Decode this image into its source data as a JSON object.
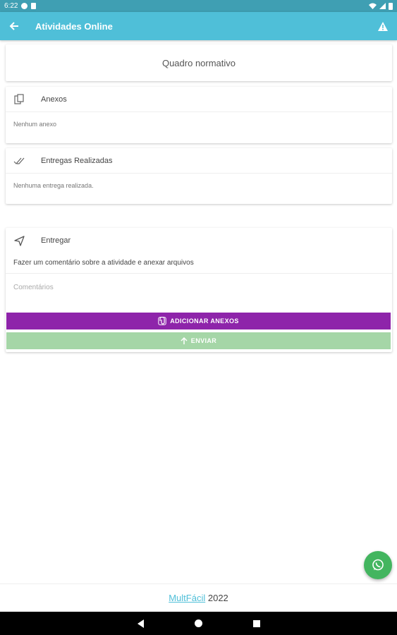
{
  "status": {
    "time": "6:22"
  },
  "appbar": {
    "title": "Atividades Online",
    "back_icon": "arrow-left-icon",
    "warning_icon": "warning-icon"
  },
  "quadro": {
    "label": "Quadro normativo"
  },
  "anexos": {
    "title": "Anexos",
    "empty": "Nenhum anexo"
  },
  "entregas": {
    "title": "Entregas Realizadas",
    "empty": "Nenhuma entrega realizada."
  },
  "entregar": {
    "title": "Entregar",
    "description": "Fazer um comentário sobre a atividade e anexar arquivos",
    "comment_placeholder": "Comentários",
    "add_label": "ADICIONAR ANEXOS",
    "send_label": "ENVIAR"
  },
  "footer": {
    "brand": "MultFácil",
    "year": "2022"
  },
  "colors": {
    "primary": "#4fbfd8",
    "add_button": "#8e24aa",
    "send_button": "#a5d6a7",
    "whatsapp": "#43b55f"
  }
}
